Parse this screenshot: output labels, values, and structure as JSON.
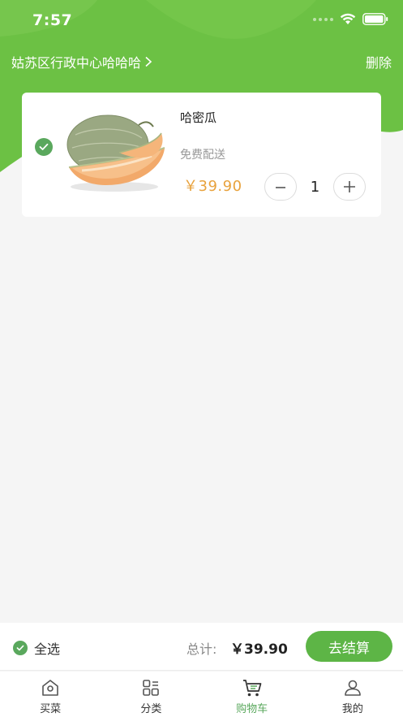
{
  "status_bar": {
    "time": "7:57"
  },
  "header": {
    "location": "姑苏区行政中心哈哈哈",
    "delete_label": "删除"
  },
  "cart_item": {
    "name": "哈密瓜",
    "delivery": "免费配送",
    "price": "￥39.90",
    "quantity": "1",
    "checked": true,
    "image_icon": "cantaloupe-image"
  },
  "checkout": {
    "select_all_label": "全选",
    "total_label": "总计:",
    "total_value": "￥39.90",
    "button_label": "去结算"
  },
  "tabs": [
    {
      "label": "买菜",
      "icon": "home-icon",
      "active": false
    },
    {
      "label": "分类",
      "icon": "category-icon",
      "active": false
    },
    {
      "label": "购物车",
      "icon": "cart-icon",
      "active": true
    },
    {
      "label": "我的",
      "icon": "profile-icon",
      "active": false
    }
  ],
  "colors": {
    "brand_green": "#5db546",
    "header_green": "#6cc144",
    "price_orange": "#e8a23d"
  }
}
